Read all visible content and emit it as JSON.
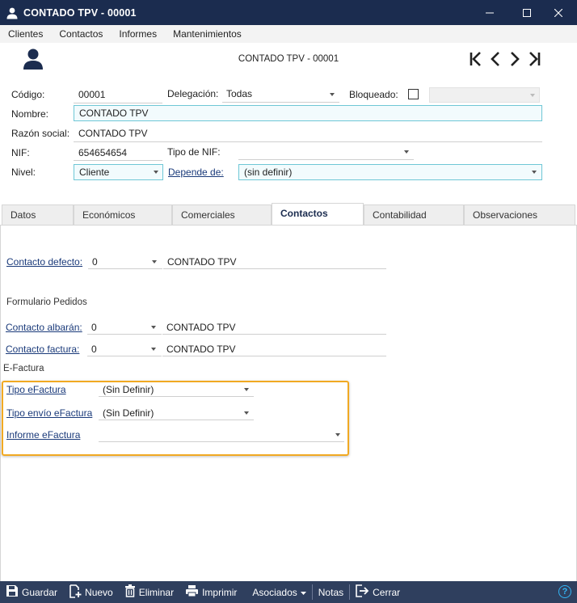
{
  "window": {
    "title": "CONTADO TPV - 00001",
    "minimize": "—",
    "maximize": "☐",
    "close": "✕"
  },
  "menu": [
    "Clientes",
    "Contactos",
    "Informes",
    "Mantenimientos"
  ],
  "header": {
    "title": "CONTADO TPV - 00001",
    "nav": [
      "first-record-icon",
      "previous-record-icon",
      "next-record-icon",
      "last-record-icon"
    ]
  },
  "form": {
    "codigo_label": "Código:",
    "codigo_value": "00001",
    "delegacion_label": "Delegación:",
    "delegacion_value": "Todas",
    "bloqueado_label": "Bloqueado:",
    "nombre_label": "Nombre:",
    "nombre_value": "CONTADO TPV",
    "razon_label": "Razón social:",
    "razon_value": "CONTADO TPV",
    "nif_label": "NIF:",
    "nif_value": "654654654",
    "tipo_nif_label": "Tipo de NIF:",
    "tipo_nif_value": "",
    "nivel_label": "Nivel:",
    "nivel_value": "Cliente",
    "depende_label": "Depende de:",
    "depende_value": "(sin definir)"
  },
  "tabs": [
    {
      "label": "Datos",
      "active": false
    },
    {
      "label": "Económicos",
      "active": false
    },
    {
      "label": "Comerciales",
      "active": false
    },
    {
      "label": "Contactos",
      "active": true
    },
    {
      "label": "Contabilidad",
      "active": false
    },
    {
      "label": "Observaciones",
      "active": false
    }
  ],
  "contactos": {
    "contacto_defecto_label": "Contacto defecto:",
    "contacto_defecto_num": "0",
    "contacto_defecto_name": "CONTADO TPV",
    "formulario_pedidos": "Formulario Pedidos",
    "albaran_label": "Contacto albarán:",
    "albaran_num": "0",
    "albaran_name": "CONTADO TPV",
    "factura_label": "Contacto factura:",
    "factura_num": "0",
    "factura_name": "CONTADO TPV",
    "efactura_section": "E-Factura",
    "tipo_efactura_label": "Tipo eFactura",
    "tipo_efactura_value": "(Sin Definir)",
    "tipo_envio_label": "Tipo envío eFactura",
    "tipo_envio_value": "(Sin Definir)",
    "informe_label": "Informe eFactura",
    "informe_value": ""
  },
  "toolbar": {
    "guardar": "Guardar",
    "nuevo": "Nuevo",
    "eliminar": "Eliminar",
    "imprimir": "Imprimir",
    "asociados": "Asociados",
    "notas": "Notas",
    "cerrar": "Cerrar",
    "help": "?"
  },
  "colors": {
    "titlebar": "#1b2c4f",
    "bottombar": "#2f3f5e",
    "highlight": "#f1a922",
    "input_border": "#6fc7d6"
  }
}
